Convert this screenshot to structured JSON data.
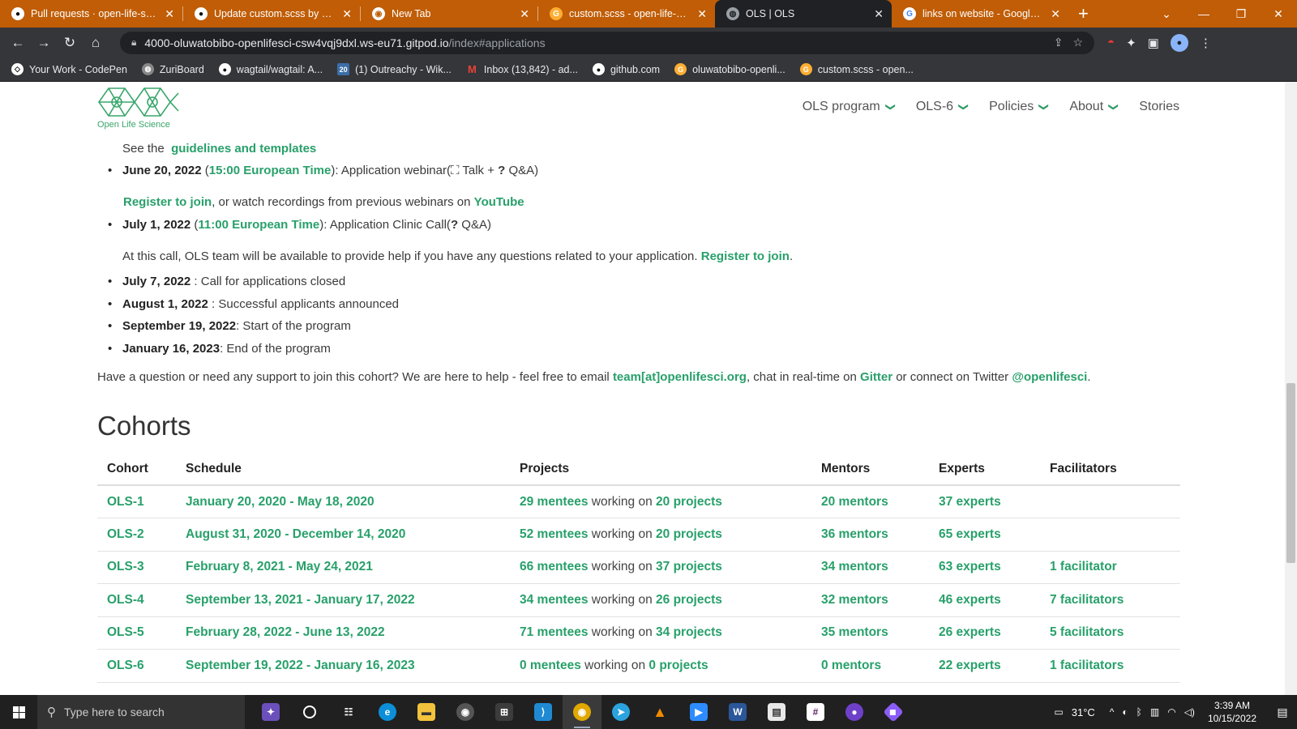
{
  "browser": {
    "tabs": [
      {
        "title": "Pull requests · open-life-scien",
        "icon": "github-icon",
        "active": false
      },
      {
        "title": "Update custom.scss by oluwa",
        "icon": "github-icon",
        "active": false
      },
      {
        "title": "New Tab",
        "icon": "chrome-icon",
        "active": false
      },
      {
        "title": "custom.scss - open-life-scienc",
        "icon": "gitpod-icon",
        "active": false
      },
      {
        "title": "OLS | OLS",
        "icon": "globe-icon",
        "active": true
      },
      {
        "title": "links on website - Google Sea",
        "icon": "google-icon",
        "active": false
      }
    ],
    "url_host": "4000-oluwatobibo-openlifesci-csw4vqj9dxl.ws-eu71.gitpod.io",
    "url_path": "/index#applications",
    "bookmarks": [
      {
        "label": "Your Work - CodePen",
        "icon": "codepen-icon"
      },
      {
        "label": "ZuriBoard",
        "icon": "zuri-icon"
      },
      {
        "label": "wagtail/wagtail: A...",
        "icon": "github-icon"
      },
      {
        "label": "(1) Outreachy - Wik...",
        "icon": "outreachy-icon"
      },
      {
        "label": "Inbox (13,842) - ad...",
        "icon": "gmail-icon"
      },
      {
        "label": "github.com",
        "icon": "github-icon"
      },
      {
        "label": "oluwatobibo-openli...",
        "icon": "gitpod-icon"
      },
      {
        "label": "custom.scss - open...",
        "icon": "gitpod-icon"
      }
    ]
  },
  "site": {
    "logo_text": "Open Life Science",
    "nav": [
      {
        "label": "OLS program",
        "dropdown": true
      },
      {
        "label": "OLS-6",
        "dropdown": true
      },
      {
        "label": "Policies",
        "dropdown": true
      },
      {
        "label": "About",
        "dropdown": true
      },
      {
        "label": "Stories",
        "dropdown": false
      }
    ]
  },
  "timeline": {
    "guidelines_prefix": "See the",
    "guidelines_link": "guidelines and templates",
    "webinar_date": "June 20, 2022",
    "webinar_paren_open": " (",
    "webinar_time": "15:00 European Time",
    "webinar_rest": "): Application webinar(",
    "webinar_talk_icon": "presenter-icon",
    "webinar_talk": " Talk + ",
    "webinar_qa": " Q&A)",
    "register_link": "Register to join",
    "recordings_text": ", or watch recordings from previous webinars on ",
    "youtube_link": "YouTube",
    "clinic_date": "July 1, 2022",
    "clinic_paren_open": " (",
    "clinic_time": "11:00 European Time",
    "clinic_rest": "): Application Clinic Call(",
    "clinic_qa": " Q&A)",
    "clinic_note": "At this call, OLS team will be available to provide help if you have any questions related to your application. ",
    "clinic_register": "Register to join",
    "clinic_note_end": ".",
    "milestones": [
      {
        "date": "July 7, 2022",
        "text": " : Call for applications closed"
      },
      {
        "date": "August 1, 2022",
        "text": " : Successful applicants announced"
      },
      {
        "date": "September 19, 2022",
        "text": ": Start of the program"
      },
      {
        "date": "January 16, 2023",
        "text": ": End of the program"
      }
    ],
    "support_text_1": "Have a question or need any support to join this cohort? We are here to help - feel free to email ",
    "support_email": "team[at]openlifesci.org",
    "support_text_2": ", chat in real-time on ",
    "support_gitter": "Gitter",
    "support_text_3": " or connect on Twitter ",
    "support_twitter": "@openlifesci",
    "support_text_4": "."
  },
  "cohorts": {
    "title": "Cohorts",
    "headers": [
      "Cohort",
      "Schedule",
      "Projects",
      "Mentors",
      "Experts",
      "Facilitators"
    ],
    "working_on": " working on ",
    "rows": [
      {
        "cohort": "OLS-1",
        "schedule": "January 20, 2020 - May 18, 2020",
        "mentees": "29 mentees",
        "projects": "20 projects",
        "mentors": "20 mentors",
        "experts": "37 experts",
        "facilitators": ""
      },
      {
        "cohort": "OLS-2",
        "schedule": "August 31, 2020 - December 14, 2020",
        "mentees": "52 mentees",
        "projects": "20 projects",
        "mentors": "36 mentors",
        "experts": "65 experts",
        "facilitators": ""
      },
      {
        "cohort": "OLS-3",
        "schedule": "February 8, 2021 - May 24, 2021",
        "mentees": "66 mentees",
        "projects": "37 projects",
        "mentors": "34 mentors",
        "experts": "63 experts",
        "facilitators": "1 facilitator"
      },
      {
        "cohort": "OLS-4",
        "schedule": "September 13, 2021 - January 17, 2022",
        "mentees": "34 mentees",
        "projects": "26 projects",
        "mentors": "32 mentors",
        "experts": "46 experts",
        "facilitators": "7 facilitators"
      },
      {
        "cohort": "OLS-5",
        "schedule": "February 28, 2022 - June 13, 2022",
        "mentees": "71 mentees",
        "projects": "34 projects",
        "mentors": "35 mentors",
        "experts": "26 experts",
        "facilitators": "5 facilitators"
      },
      {
        "cohort": "OLS-6",
        "schedule": "September 19, 2022 - January 16, 2023",
        "mentees": "0 mentees",
        "projects": "0 projects",
        "mentors": "0 mentors",
        "experts": "22 experts",
        "facilitators": "1 facilitators"
      }
    ]
  },
  "taskbar": {
    "search_placeholder": "Type here to search",
    "temperature": "31°C",
    "time": "3:39 AM",
    "date": "10/15/2022",
    "apps": [
      "search-highlight-icon",
      "cortana-icon",
      "task-view-icon",
      "edge-icon",
      "file-explorer-icon",
      "media-icon",
      "store-icon",
      "vscode-icon",
      "chrome-icon",
      "telegram-icon",
      "vlc-icon",
      "zoom-icon",
      "word-icon",
      "files-icon",
      "slack-icon",
      "github-desktop-icon",
      "git-icon"
    ]
  },
  "colors": {
    "accent": "#28a06a",
    "tabstrip": "#c05d06",
    "browser_dark": "#35363a"
  }
}
